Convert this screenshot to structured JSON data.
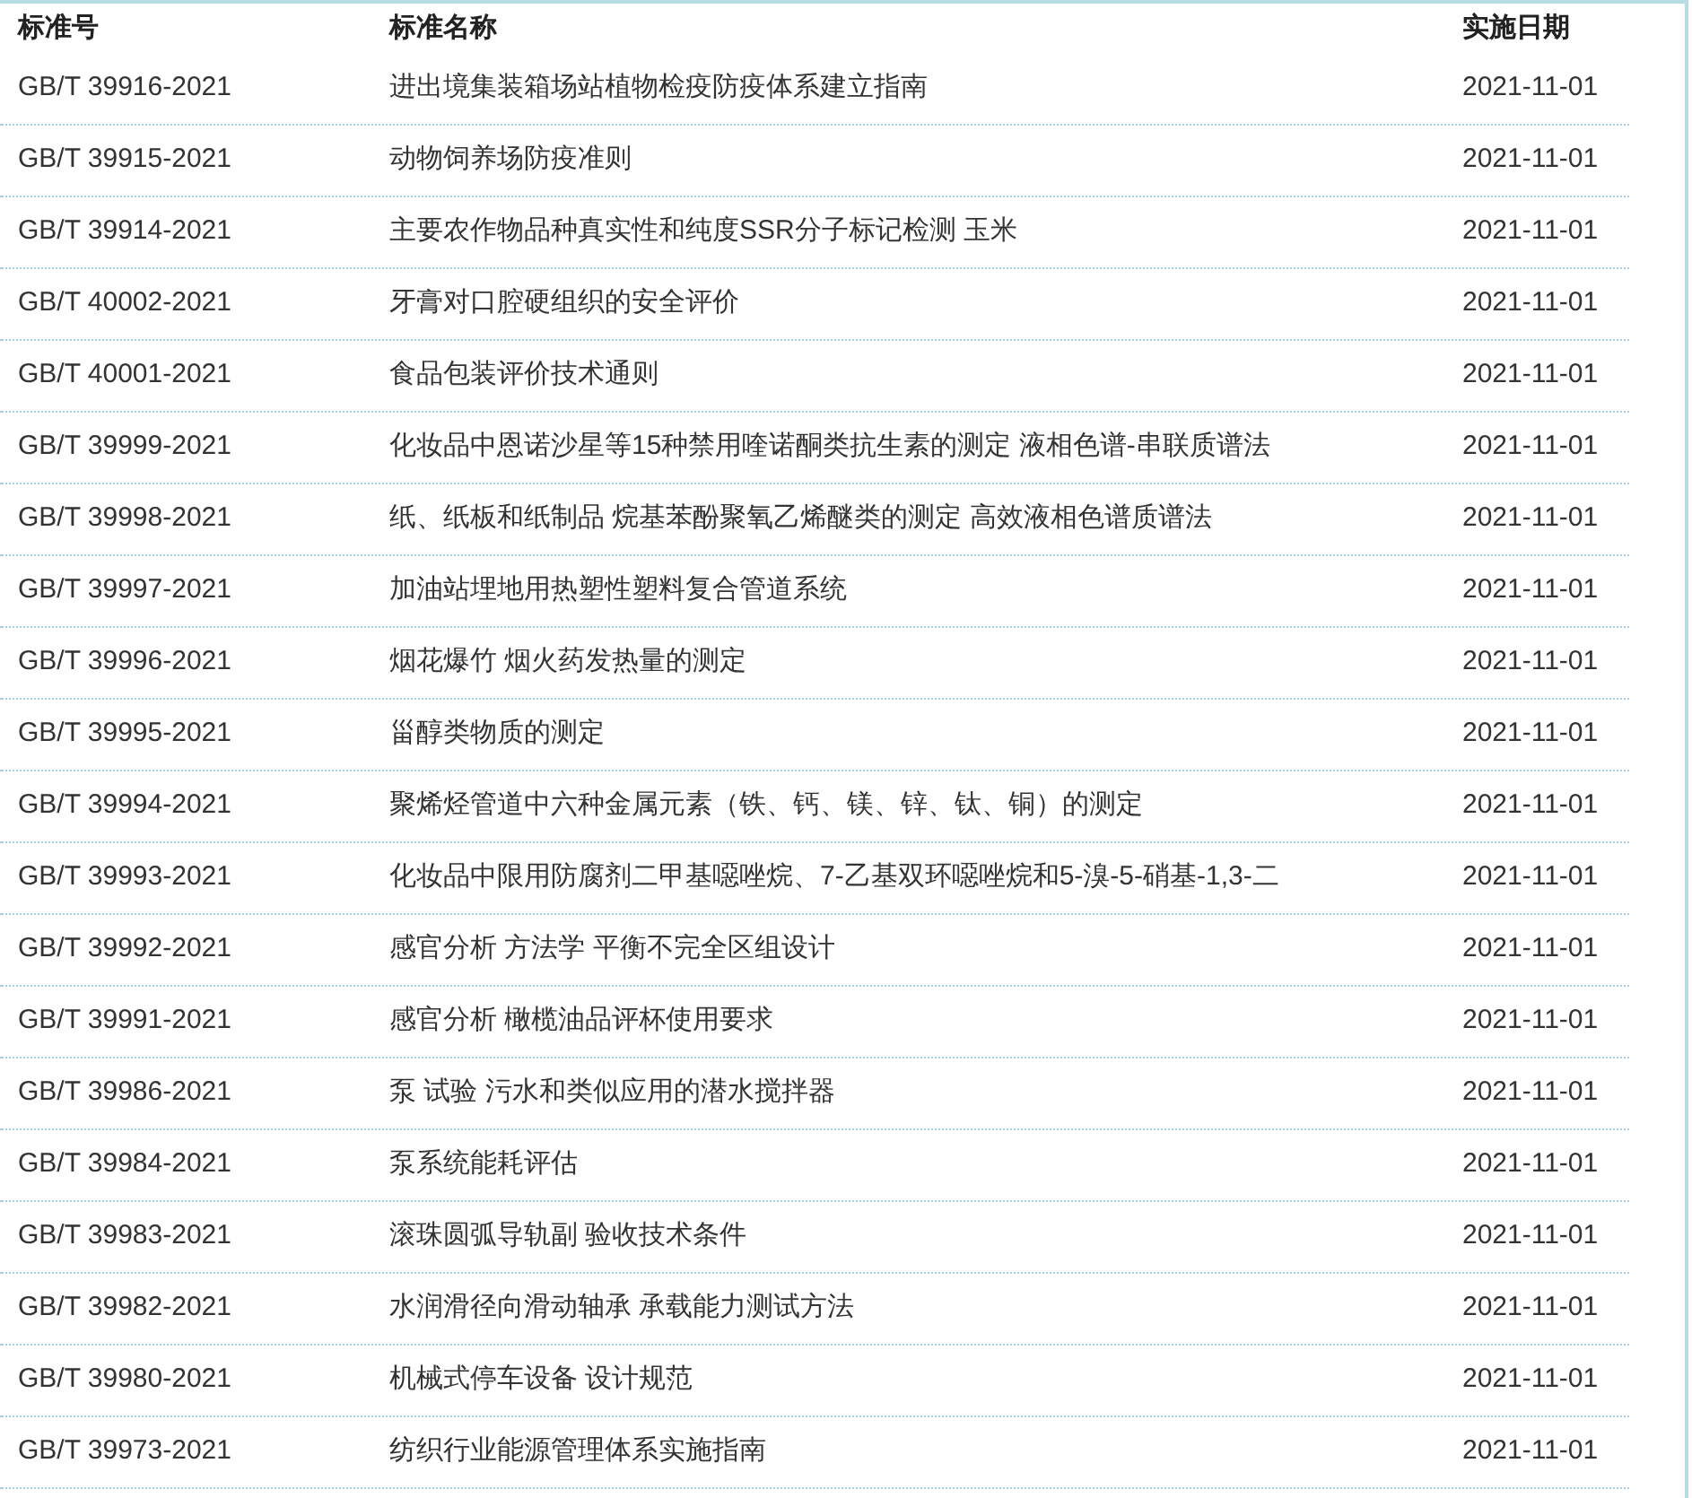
{
  "table": {
    "columns": [
      "标准号",
      "标准名称",
      "实施日期"
    ],
    "rows": [
      [
        "GB/T 39916-2021",
        "进出境集装箱场站植物检疫防疫体系建立指南",
        "2021-11-01"
      ],
      [
        "GB/T 39915-2021",
        "动物饲养场防疫准则",
        "2021-11-01"
      ],
      [
        "GB/T 39914-2021",
        "主要农作物品种真实性和纯度SSR分子标记检测 玉米",
        "2021-11-01"
      ],
      [
        "GB/T 40002-2021",
        "牙膏对口腔硬组织的安全评价",
        "2021-11-01"
      ],
      [
        "GB/T 40001-2021",
        "食品包装评价技术通则",
        "2021-11-01"
      ],
      [
        "GB/T 39999-2021",
        "化妆品中恩诺沙星等15种禁用喹诺酮类抗生素的测定 液相色谱-串联质谱法",
        "2021-11-01"
      ],
      [
        "GB/T 39998-2021",
        "纸、纸板和纸制品 烷基苯酚聚氧乙烯醚类的测定 高效液相色谱质谱法",
        "2021-11-01"
      ],
      [
        "GB/T 39997-2021",
        "加油站埋地用热塑性塑料复合管道系统",
        "2021-11-01"
      ],
      [
        "GB/T 39996-2021",
        "烟花爆竹 烟火药发热量的测定",
        "2021-11-01"
      ],
      [
        "GB/T 39995-2021",
        "甾醇类物质的测定",
        "2021-11-01"
      ],
      [
        "GB/T 39994-2021",
        "聚烯烃管道中六种金属元素（铁、钙、镁、锌、钛、铜）的测定",
        "2021-11-01"
      ],
      [
        "GB/T 39993-2021",
        "化妆品中限用防腐剂二甲基噁唑烷、7-乙基双环噁唑烷和5-溴-5-硝基-1,3-二",
        "2021-11-01"
      ],
      [
        "GB/T 39992-2021",
        "感官分析 方法学 平衡不完全区组设计",
        "2021-11-01"
      ],
      [
        "GB/T 39991-2021",
        "感官分析 橄榄油品评杯使用要求",
        "2021-11-01"
      ],
      [
        "GB/T 39986-2021",
        "泵 试验 污水和类似应用的潜水搅拌器",
        "2021-11-01"
      ],
      [
        "GB/T 39984-2021",
        "泵系统能耗评估",
        "2021-11-01"
      ],
      [
        "GB/T 39983-2021",
        "滚珠圆弧导轨副 验收技术条件",
        "2021-11-01"
      ],
      [
        "GB/T 39982-2021",
        "水润滑径向滑动轴承 承载能力测试方法",
        "2021-11-01"
      ],
      [
        "GB/T 39980-2021",
        "机械式停车设备 设计规范",
        "2021-11-01"
      ],
      [
        "GB/T 39973-2021",
        "纺织行业能源管理体系实施指南",
        "2021-11-01"
      ]
    ]
  }
}
